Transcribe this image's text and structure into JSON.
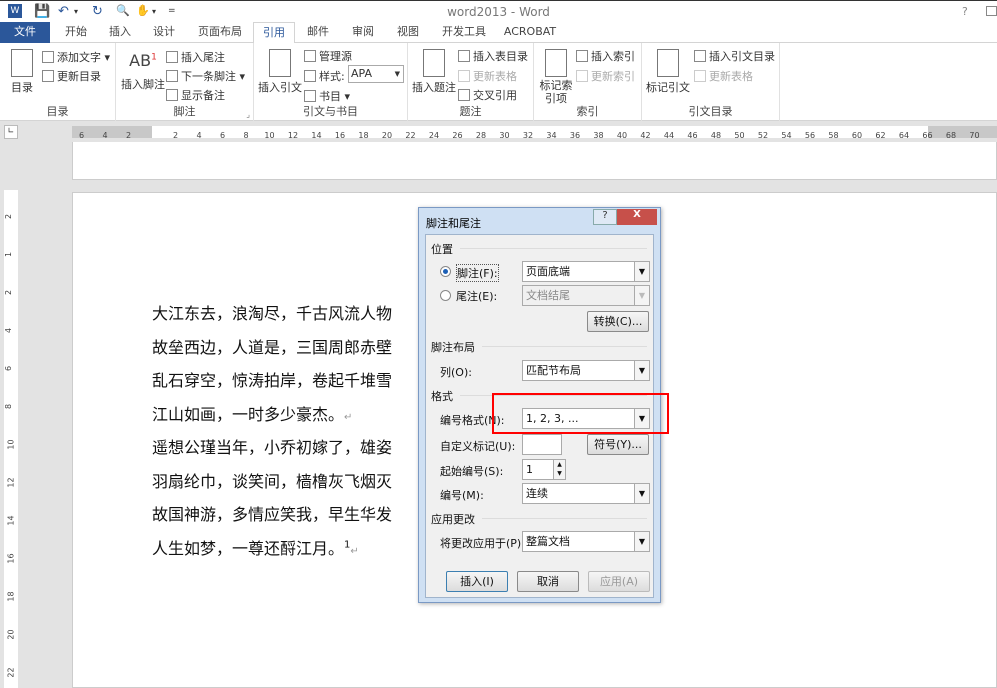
{
  "window": {
    "title": "word2013 - Word",
    "help": "?"
  },
  "quick_access": [
    "W",
    "💾",
    "↶",
    "▾",
    "↻",
    "🔍",
    "✋",
    "▾",
    "="
  ],
  "tabs": [
    "文件",
    "开始",
    "插入",
    "设计",
    "页面布局",
    "引用",
    "邮件",
    "审阅",
    "视图",
    "开发工具",
    "ACROBAT"
  ],
  "active_tab": "引用",
  "ribbon": {
    "toc": {
      "label": "目录",
      "big": "目录",
      "add_text": "添加文字 ▾",
      "update": "更新目录"
    },
    "footnotes": {
      "label": "脚注",
      "insert_footnote": "插入脚注",
      "insert_endnote": "插入尾注",
      "next_footnote": "下一条脚注",
      "show_notes": "显示备注"
    },
    "citations": {
      "label": "引文与书目",
      "insert_citation": "插入引文",
      "manage_sources": "管理源",
      "style_label": "样式:",
      "style_value": "APA",
      "bibliography": "书目 ▾"
    },
    "captions": {
      "label": "题注",
      "insert_caption": "插入题注",
      "insert_table_of_figures": "插入表目录",
      "update_table": "更新表格",
      "cross_reference": "交叉引用"
    },
    "index": {
      "label": "索引",
      "mark_entry": "标记索引项",
      "insert_index": "插入索引",
      "update_index": "更新索引"
    },
    "authorities": {
      "label": "引文目录",
      "mark_citation": "标记引文",
      "insert_toa": "插入引文目录",
      "update_table": "更新表格"
    }
  },
  "ruler": {
    "left_nums": [
      "6",
      "4",
      "2"
    ],
    "right_nums": [
      "2",
      "4",
      "6",
      "8",
      "10",
      "12",
      "14",
      "16",
      "18",
      "20",
      "22",
      "24",
      "26",
      "28",
      "30",
      "32",
      "34",
      "36",
      "38",
      "40",
      "42",
      "44",
      "46",
      "48",
      "50",
      "52",
      "54",
      "56",
      "58",
      "60",
      "62",
      "64",
      "66"
    ],
    "margin_nums": [
      "68",
      "70"
    ],
    "vertical_nums": [
      "2",
      "1",
      "2",
      "4",
      "6",
      "8",
      "10",
      "12",
      "14",
      "16",
      "18",
      "20",
      "22"
    ]
  },
  "document": {
    "lines": [
      "大江东去，浪淘尽，千古风流人物",
      "故垒西边，人道是，三国周郎赤壁",
      "乱石穿空，惊涛拍岸，卷起千堆雪",
      "江山如画，一时多少豪杰。",
      "遥想公瑾当年，小乔初嫁了，雄姿",
      "羽扇纶巾，谈笑间，樯橹灰飞烟灭",
      "故国神游，多情应笑我，早生华发",
      "人生如梦，一尊还酹江月。"
    ],
    "footnote_ref": "1",
    "para_mark": "↵"
  },
  "dialog": {
    "title": "脚注和尾注",
    "help": "?",
    "close": "X",
    "location": {
      "heading": "位置",
      "footnote_label": "脚注(F):",
      "footnote_value": "页面底端",
      "endnote_label": "尾注(E):",
      "endnote_value": "文档结尾",
      "convert": "转换(C)...",
      "selected": "footnote"
    },
    "layout": {
      "heading": "脚注布局",
      "columns_label": "列(O):",
      "columns_value": "匹配节布局"
    },
    "format": {
      "heading": "格式",
      "number_format_label": "编号格式(N):",
      "number_format_value": "1, 2, 3, ...",
      "custom_mark_label": "自定义标记(U):",
      "custom_mark_value": "",
      "symbol": "符号(Y)...",
      "start_at_label": "起始编号(S):",
      "start_at_value": "1",
      "numbering_label": "编号(M):",
      "numbering_value": "连续"
    },
    "apply": {
      "heading": "应用更改",
      "apply_to_label": "将更改应用于(P):",
      "apply_to_value": "整篇文档"
    },
    "buttons": {
      "insert": "插入(I)",
      "cancel": "取消",
      "apply": "应用(A)"
    }
  },
  "highlight_color": "#ff0000"
}
